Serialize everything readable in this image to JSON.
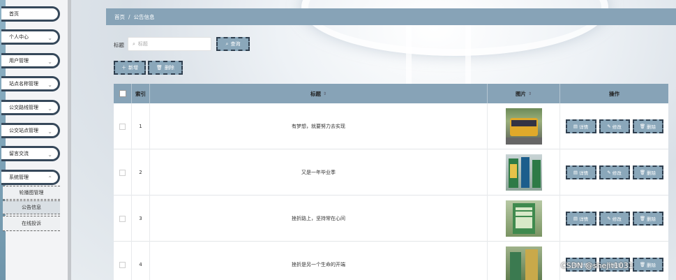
{
  "sidebar": {
    "items": [
      {
        "label": "首页",
        "chevron": false
      },
      {
        "label": "个人中心",
        "chevron": true
      },
      {
        "label": "用户管理",
        "chevron": true
      },
      {
        "label": "站点名称管理",
        "chevron": true
      },
      {
        "label": "公交路线管理",
        "chevron": true
      },
      {
        "label": "公交站点管理",
        "chevron": true
      },
      {
        "label": "留言交流",
        "chevron": true
      },
      {
        "label": "系统管理",
        "chevron": true
      }
    ],
    "submenu": [
      {
        "label": "轮播图管理",
        "active": false
      },
      {
        "label": "公告信息",
        "active": true
      },
      {
        "label": "在线投诉",
        "active": false
      }
    ]
  },
  "breadcrumb": {
    "home": "首页",
    "separator": "/",
    "current": "公告信息"
  },
  "search": {
    "label": "标题",
    "placeholder": "标题",
    "button_label": "查询"
  },
  "toolbar": {
    "add_label": "新增",
    "delete_label": "删除"
  },
  "table": {
    "headers": {
      "index": "索引",
      "title": "标题",
      "image": "图片",
      "actions": "操作"
    },
    "rows": [
      {
        "index": "1",
        "title": "有梦想，就要努力去实现",
        "image": "bus-photo"
      },
      {
        "index": "2",
        "title": "又是一年毕业季",
        "image": "bus-stop-sign-photo"
      },
      {
        "index": "3",
        "title": "挫折路上，坚持常在心间",
        "image": "station-board-photo"
      },
      {
        "index": "4",
        "title": "挫折是另一个生命的开端",
        "image": "street-board-photo"
      }
    ],
    "actions": {
      "detail": "详情",
      "edit": "修改",
      "delete": "删除"
    }
  },
  "watermark": "CSDN @shejit1031",
  "colors": {
    "accent": "#87a3b7",
    "button": "#8aa7ba",
    "border": "#2f3f4f"
  }
}
